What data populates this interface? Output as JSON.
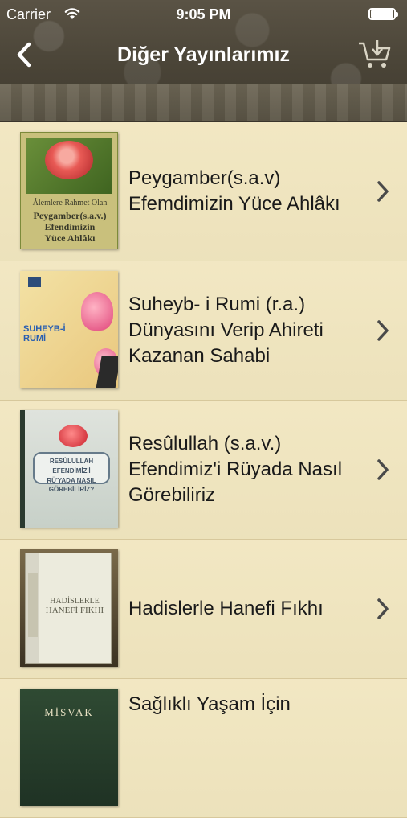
{
  "status_bar": {
    "carrier": "Carrier",
    "time": "9:05 PM",
    "icons": [
      "wifi-icon",
      "battery-icon"
    ]
  },
  "nav": {
    "title": "Diğer Yayınlarımız",
    "back_icon": "chevron-left-icon",
    "download_icon": "cart-download-icon"
  },
  "colors": {
    "header_dark": "#4a4437",
    "paper": "#f1e6bf",
    "text": "#1a1a1a",
    "chevron": "#4a4a4a"
  },
  "books": [
    {
      "title": "Peygamber(s.a.v) Efemdimizin Yüce Ahlâkı",
      "cover_lines": [
        "Âlemlere Rahmet Olan",
        "Peygamber(s.a.v.)",
        "Efendimizin",
        "Yüce Ahlâkı"
      ]
    },
    {
      "title": "Suheyb- i Rumi (r.a.) Dünyasını Verip Ahireti Kazanan Sahabi",
      "cover_lines": [
        "SUHEYB-İ",
        "RUMİ"
      ]
    },
    {
      "title": "Resûlullah (s.a.v.) Efendimiz'i Rüyada Nasıl Görebiliriz",
      "cover_lines": [
        "RESÛLULLAH",
        "EFENDİMİZ'İ",
        "RÜ'YADA NASIL",
        "GÖREBİLİRİZ?"
      ]
    },
    {
      "title": "Hadislerle Hanefi Fıkhı",
      "cover_lines": [
        "HADİSLERLE",
        "HANEFİ FIKHI"
      ]
    },
    {
      "title": "Sağlıklı Yaşam İçin",
      "cover_lines": [
        "MİSVAK"
      ]
    }
  ]
}
